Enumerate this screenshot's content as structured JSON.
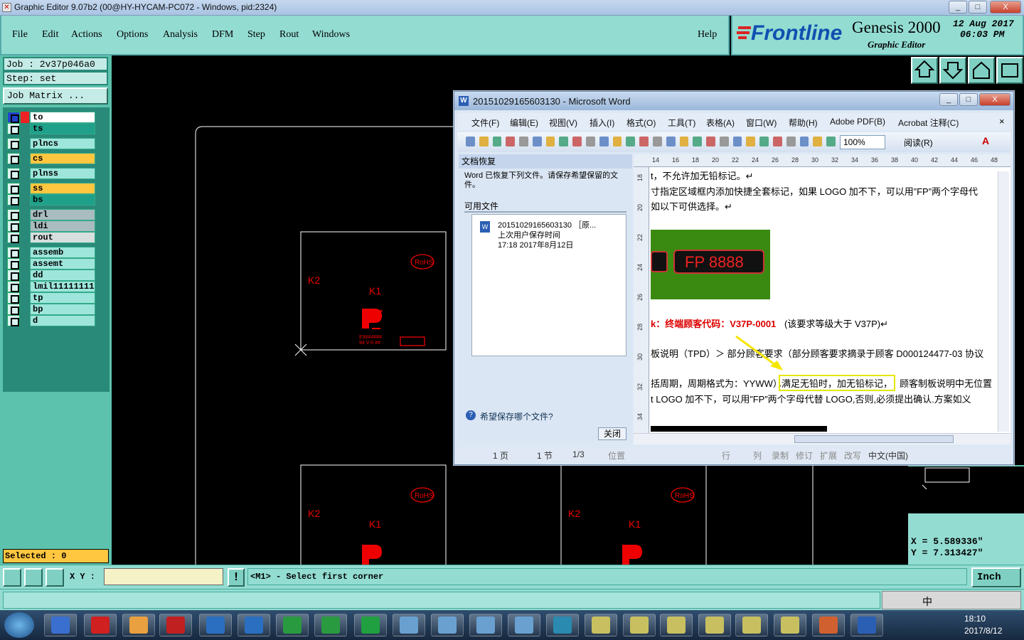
{
  "window": {
    "title": "Graphic Editor 9.07b2 (00@HY-HYCAM-PC072 - Windows, pid:2324)",
    "min": "_",
    "max": "□",
    "close": "X"
  },
  "menu": {
    "items": [
      "File",
      "Edit",
      "Actions",
      "Options",
      "Analysis",
      "DFM",
      "Step",
      "Rout",
      "Windows"
    ],
    "help": "Help"
  },
  "logo": {
    "brand": "Frontline",
    "product": "Genesis 2000",
    "sub": "Graphic Editor",
    "date": "12 Aug 2017",
    "time": "06:03 PM"
  },
  "job": {
    "job_line": "Job : 2v37p046a0",
    "step_line": "Step: set",
    "matrix_button": "Job Matrix ..."
  },
  "layers": [
    {
      "name": "to",
      "color": "#ffffff",
      "group": 0
    },
    {
      "name": "ts",
      "color": "#1fa08a",
      "group": 0
    },
    {
      "name": "plncs",
      "color": "#9ee6dc",
      "group": 1
    },
    {
      "name": "cs",
      "color": "#ffc640",
      "group": 2
    },
    {
      "name": "plnss",
      "color": "#9ee6dc",
      "group": 3
    },
    {
      "name": "ss",
      "color": "#ffc640",
      "group": 4
    },
    {
      "name": "bs",
      "color": "#1fa08a",
      "group": 4
    },
    {
      "name": "drl",
      "color": "#a9bcc0",
      "group": 5
    },
    {
      "name": "ldi",
      "color": "#a9bcc0",
      "group": 5
    },
    {
      "name": "rout",
      "color": "#d6dede",
      "group": 5
    },
    {
      "name": "assemb",
      "color": "#9ee6dc",
      "group": 6
    },
    {
      "name": "assemt",
      "color": "#9ee6dc",
      "group": 6
    },
    {
      "name": "dd",
      "color": "#9ee6dc",
      "group": 6
    },
    {
      "name": "lmil11111111",
      "color": "#9ee6dc",
      "group": 6
    },
    {
      "name": "tp",
      "color": "#9ee6dc",
      "group": 6
    },
    {
      "name": "bp",
      "color": "#9ee6dc",
      "group": 6
    },
    {
      "name": "d",
      "color": "#9ee6dc",
      "group": 6
    }
  ],
  "selected": "Selected : 0",
  "canvas": {
    "k1": "K1",
    "k2": "K2",
    "rohs": "RoHS"
  },
  "coords": {
    "x": "X  =  5.589336\"",
    "y": "Y  =  7.313427\""
  },
  "command": {
    "xy_label": "X Y :",
    "xy_value": "",
    "prompt": "<M1> - Select first corner",
    "unit": "Inch"
  },
  "word": {
    "title": "20151029165603130 - Microsoft Word",
    "menu": [
      "文件(F)",
      "编辑(E)",
      "视图(V)",
      "插入(I)",
      "格式(O)",
      "工具(T)",
      "表格(A)",
      "窗口(W)",
      "帮助(H)",
      "Adobe PDF(B)",
      "Acrobat 注释(C)"
    ],
    "zoom": "100%",
    "read": "阅读(R)",
    "ruler": [
      "14",
      "16",
      "18",
      "20",
      "22",
      "24",
      "26",
      "28",
      "30",
      "32",
      "34",
      "36",
      "38",
      "40",
      "42",
      "44",
      "46",
      "48"
    ],
    "vruler": [
      "18",
      "20",
      "22",
      "24",
      "26",
      "28",
      "30",
      "32",
      "34"
    ],
    "pane_title": "文档恢复",
    "pane_desc": "Word 已恢复下列文件。请保存希望保留的文件。",
    "pane_avail": "可用文件",
    "file_name": "20151029165603130 ［原...",
    "file_line2": "上次用户保存时间",
    "file_line3": "17:18 2017年8月12日",
    "pane_help": "希望保存哪个文件?",
    "pane_close": "关闭",
    "doc_lines": [
      "t，不允许加无铅标记。↵",
      "寸指定区域框内添加快捷全套标记，如果 LOGO 加不下，可以用”FP”两个字母代",
      "如以下可供选择。↵",
      "k：终端顾客代码：V37P-0001",
      "(该要求等级大于 V37P)↵",
      "板说明（TPD）＞  部分顾客要求（部分顾客要求摘录于顾客 D000124477-03 协议",
      "括周期，周期格式为：YYWW），",
      "满足无铅时，加无铅标记，",
      "顾客制板说明中无位置",
      "t LOGO 加不下，可以用”FP”两个字母代替 LOGO,否则,必须提出确认.方案如义"
    ],
    "image_text": "FP 8888",
    "status": [
      "1 页",
      "1 节",
      "1/3",
      "位置",
      "行",
      "列",
      "录制",
      "修订",
      "扩展",
      "改写",
      "中文(中国)"
    ]
  },
  "taskbar": {
    "time": "18:10",
    "date": "2017/8/12",
    "ime": "中"
  }
}
